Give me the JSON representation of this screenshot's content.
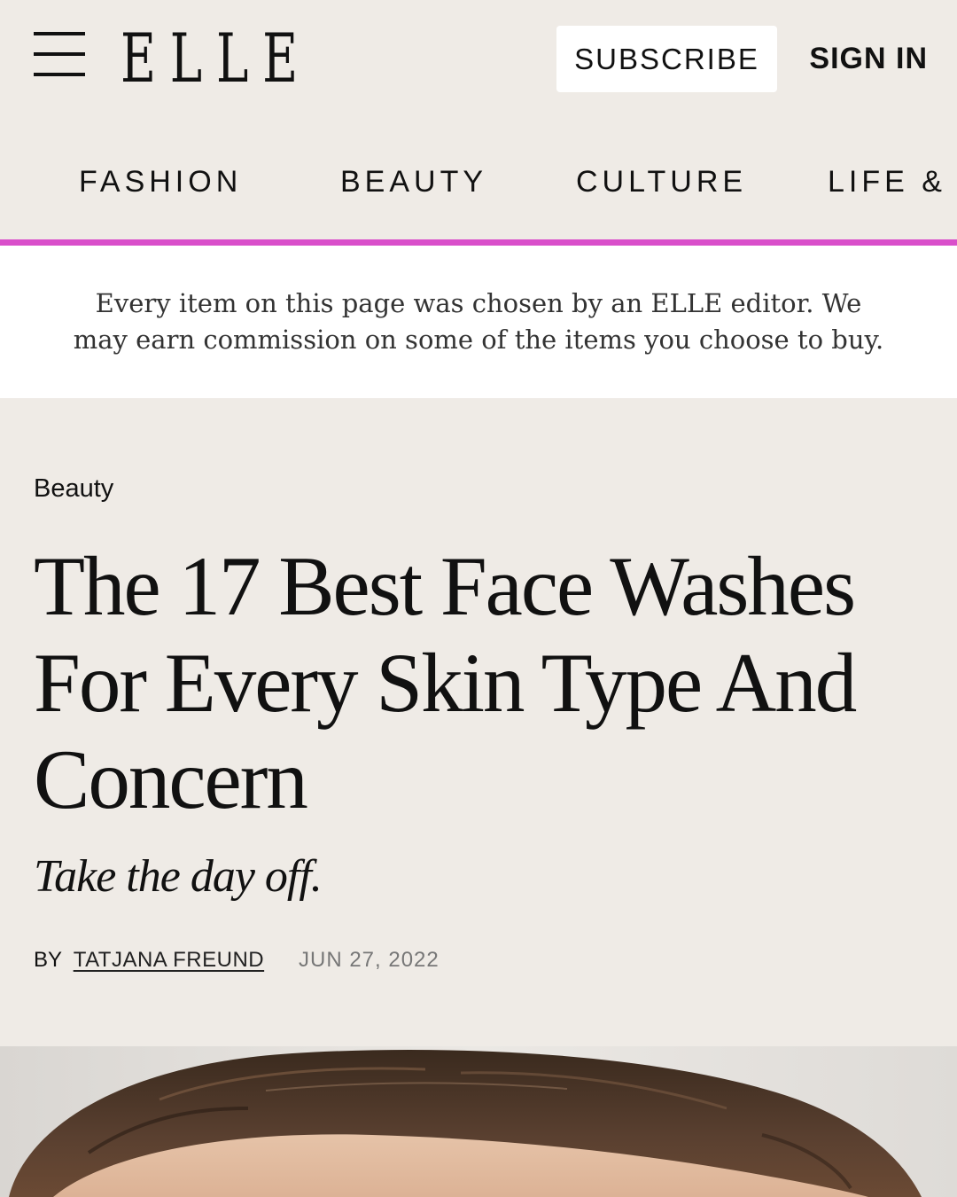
{
  "header": {
    "logo": "ELLE",
    "subscribe_label": "SUBSCRIBE",
    "signin_label": "SIGN IN"
  },
  "nav": {
    "items": [
      {
        "label": "FASHION"
      },
      {
        "label": "BEAUTY"
      },
      {
        "label": "CULTURE"
      },
      {
        "label": "LIFE &"
      }
    ]
  },
  "disclaimer": {
    "text": "Every item on this page was chosen by an ELLE editor. We may earn commission on some of the items you choose to buy."
  },
  "article": {
    "category": "Beauty",
    "headline": "The 17 Best Face Washes For Every Skin Type And Concern",
    "dek": "Take the day off.",
    "byline_prefix": "BY",
    "author": "TATJANA FREUND",
    "date": "JUN 27, 2022"
  },
  "colors": {
    "accent": "#d94fca",
    "background": "#efebe6"
  },
  "icons": {
    "menu": "hamburger-menu-icon"
  }
}
